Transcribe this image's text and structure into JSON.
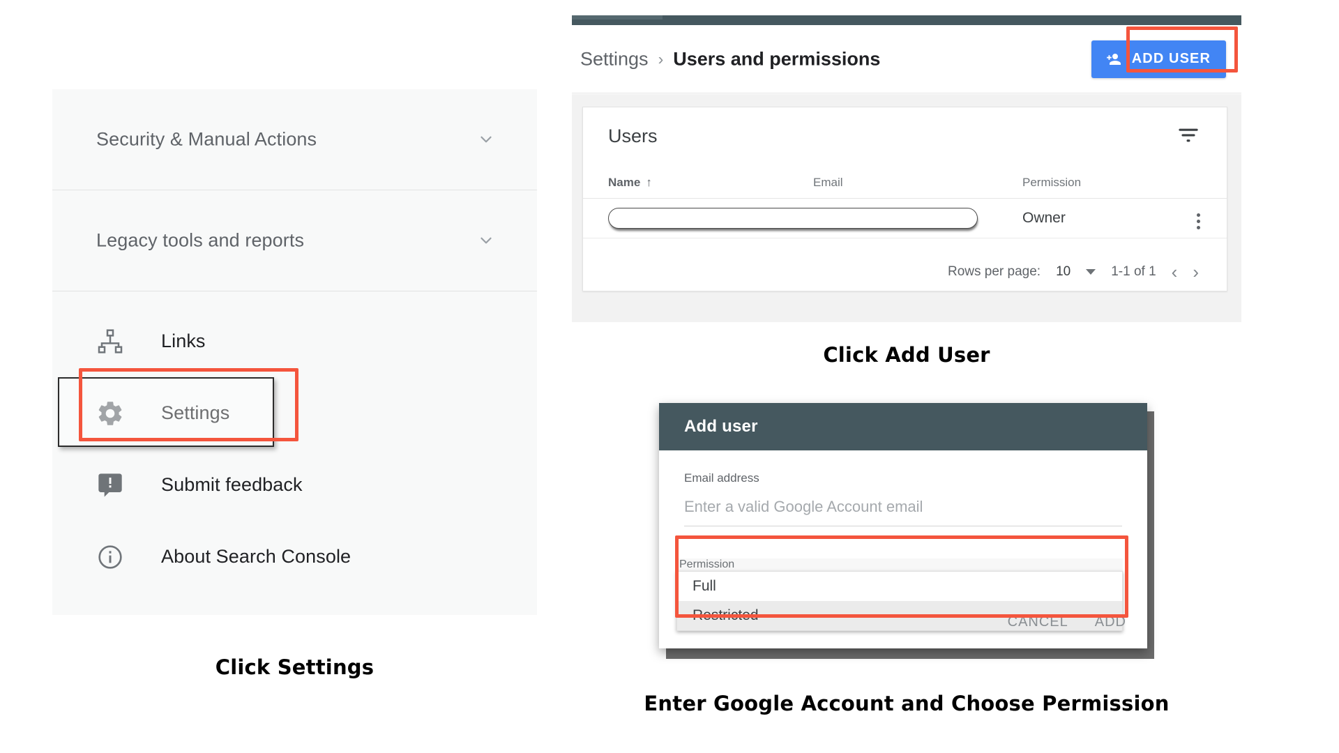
{
  "sidebar": {
    "groups": [
      {
        "label": "Security & Manual Actions",
        "icon": "chevron-down-icon"
      },
      {
        "label": "Legacy tools and reports",
        "icon": "chevron-down-icon"
      }
    ],
    "items": [
      {
        "label": "Links",
        "icon": "sitemap-icon"
      },
      {
        "label": "Settings",
        "icon": "gear-icon"
      },
      {
        "label": "Submit feedback",
        "icon": "feedback-icon"
      },
      {
        "label": "About Search Console",
        "icon": "info-icon"
      }
    ]
  },
  "gsc": {
    "breadcrumb": {
      "root": "Settings",
      "separator": "›",
      "current": "Users and permissions"
    },
    "add_user_button": "ADD USER",
    "card": {
      "title": "Users",
      "filter_icon": "filter-icon",
      "columns": [
        "Name",
        "Email",
        "Permission"
      ],
      "sort_indicator": "↑",
      "rows": [
        {
          "name": "",
          "email": "",
          "permission": "Owner",
          "menu": "more-options-icon"
        }
      ],
      "pagination": {
        "rows_per_page_label": "Rows per page:",
        "rows_per_page_value": "10",
        "range": "1-1 of 1",
        "prev": "‹",
        "next": "›"
      }
    }
  },
  "dialog": {
    "title": "Add user",
    "email_label": "Email address",
    "email_value": "",
    "email_placeholder": "Enter a valid Google Account email",
    "permission_label": "Permission",
    "permission_options": [
      {
        "label": "Full",
        "selected": false
      },
      {
        "label": "Restricted",
        "selected": true
      }
    ],
    "cancel_button": "CANCEL",
    "add_button": "ADD"
  },
  "captions": {
    "left": "Click Settings",
    "top_right": "Click Add User",
    "bottom_right": "Enter Google Account and Choose Permission"
  },
  "colors": {
    "highlight": "#f4553d",
    "primary_button": "#4285f4",
    "dialog_header": "#45585f",
    "sidebar_bg": "#f8f9f9"
  }
}
